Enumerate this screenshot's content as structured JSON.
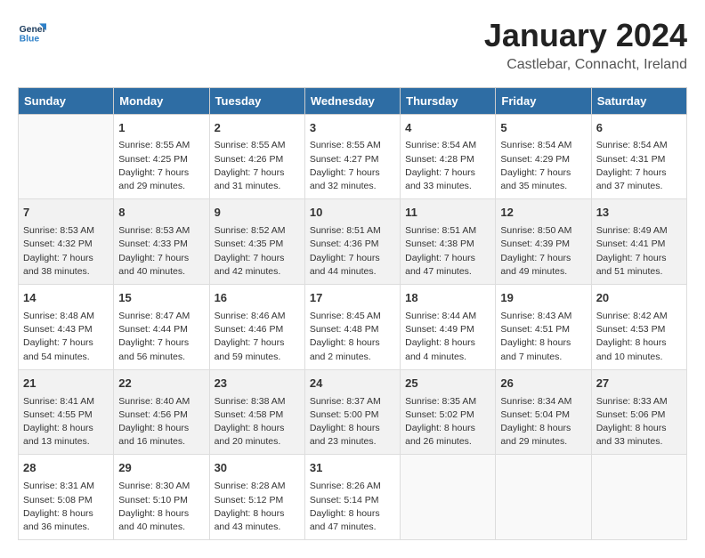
{
  "header": {
    "logo_line1": "General",
    "logo_line2": "Blue",
    "title": "January 2024",
    "subtitle": "Castlebar, Connacht, Ireland"
  },
  "calendar": {
    "weekdays": [
      "Sunday",
      "Monday",
      "Tuesday",
      "Wednesday",
      "Thursday",
      "Friday",
      "Saturday"
    ],
    "weeks": [
      [
        {
          "day": "",
          "info": ""
        },
        {
          "day": "1",
          "info": "Sunrise: 8:55 AM\nSunset: 4:25 PM\nDaylight: 7 hours\nand 29 minutes."
        },
        {
          "day": "2",
          "info": "Sunrise: 8:55 AM\nSunset: 4:26 PM\nDaylight: 7 hours\nand 31 minutes."
        },
        {
          "day": "3",
          "info": "Sunrise: 8:55 AM\nSunset: 4:27 PM\nDaylight: 7 hours\nand 32 minutes."
        },
        {
          "day": "4",
          "info": "Sunrise: 8:54 AM\nSunset: 4:28 PM\nDaylight: 7 hours\nand 33 minutes."
        },
        {
          "day": "5",
          "info": "Sunrise: 8:54 AM\nSunset: 4:29 PM\nDaylight: 7 hours\nand 35 minutes."
        },
        {
          "day": "6",
          "info": "Sunrise: 8:54 AM\nSunset: 4:31 PM\nDaylight: 7 hours\nand 37 minutes."
        }
      ],
      [
        {
          "day": "7",
          "info": "Sunrise: 8:53 AM\nSunset: 4:32 PM\nDaylight: 7 hours\nand 38 minutes."
        },
        {
          "day": "8",
          "info": "Sunrise: 8:53 AM\nSunset: 4:33 PM\nDaylight: 7 hours\nand 40 minutes."
        },
        {
          "day": "9",
          "info": "Sunrise: 8:52 AM\nSunset: 4:35 PM\nDaylight: 7 hours\nand 42 minutes."
        },
        {
          "day": "10",
          "info": "Sunrise: 8:51 AM\nSunset: 4:36 PM\nDaylight: 7 hours\nand 44 minutes."
        },
        {
          "day": "11",
          "info": "Sunrise: 8:51 AM\nSunset: 4:38 PM\nDaylight: 7 hours\nand 47 minutes."
        },
        {
          "day": "12",
          "info": "Sunrise: 8:50 AM\nSunset: 4:39 PM\nDaylight: 7 hours\nand 49 minutes."
        },
        {
          "day": "13",
          "info": "Sunrise: 8:49 AM\nSunset: 4:41 PM\nDaylight: 7 hours\nand 51 minutes."
        }
      ],
      [
        {
          "day": "14",
          "info": "Sunrise: 8:48 AM\nSunset: 4:43 PM\nDaylight: 7 hours\nand 54 minutes."
        },
        {
          "day": "15",
          "info": "Sunrise: 8:47 AM\nSunset: 4:44 PM\nDaylight: 7 hours\nand 56 minutes."
        },
        {
          "day": "16",
          "info": "Sunrise: 8:46 AM\nSunset: 4:46 PM\nDaylight: 7 hours\nand 59 minutes."
        },
        {
          "day": "17",
          "info": "Sunrise: 8:45 AM\nSunset: 4:48 PM\nDaylight: 8 hours\nand 2 minutes."
        },
        {
          "day": "18",
          "info": "Sunrise: 8:44 AM\nSunset: 4:49 PM\nDaylight: 8 hours\nand 4 minutes."
        },
        {
          "day": "19",
          "info": "Sunrise: 8:43 AM\nSunset: 4:51 PM\nDaylight: 8 hours\nand 7 minutes."
        },
        {
          "day": "20",
          "info": "Sunrise: 8:42 AM\nSunset: 4:53 PM\nDaylight: 8 hours\nand 10 minutes."
        }
      ],
      [
        {
          "day": "21",
          "info": "Sunrise: 8:41 AM\nSunset: 4:55 PM\nDaylight: 8 hours\nand 13 minutes."
        },
        {
          "day": "22",
          "info": "Sunrise: 8:40 AM\nSunset: 4:56 PM\nDaylight: 8 hours\nand 16 minutes."
        },
        {
          "day": "23",
          "info": "Sunrise: 8:38 AM\nSunset: 4:58 PM\nDaylight: 8 hours\nand 20 minutes."
        },
        {
          "day": "24",
          "info": "Sunrise: 8:37 AM\nSunset: 5:00 PM\nDaylight: 8 hours\nand 23 minutes."
        },
        {
          "day": "25",
          "info": "Sunrise: 8:35 AM\nSunset: 5:02 PM\nDaylight: 8 hours\nand 26 minutes."
        },
        {
          "day": "26",
          "info": "Sunrise: 8:34 AM\nSunset: 5:04 PM\nDaylight: 8 hours\nand 29 minutes."
        },
        {
          "day": "27",
          "info": "Sunrise: 8:33 AM\nSunset: 5:06 PM\nDaylight: 8 hours\nand 33 minutes."
        }
      ],
      [
        {
          "day": "28",
          "info": "Sunrise: 8:31 AM\nSunset: 5:08 PM\nDaylight: 8 hours\nand 36 minutes."
        },
        {
          "day": "29",
          "info": "Sunrise: 8:30 AM\nSunset: 5:10 PM\nDaylight: 8 hours\nand 40 minutes."
        },
        {
          "day": "30",
          "info": "Sunrise: 8:28 AM\nSunset: 5:12 PM\nDaylight: 8 hours\nand 43 minutes."
        },
        {
          "day": "31",
          "info": "Sunrise: 8:26 AM\nSunset: 5:14 PM\nDaylight: 8 hours\nand 47 minutes."
        },
        {
          "day": "",
          "info": ""
        },
        {
          "day": "",
          "info": ""
        },
        {
          "day": "",
          "info": ""
        }
      ]
    ]
  }
}
